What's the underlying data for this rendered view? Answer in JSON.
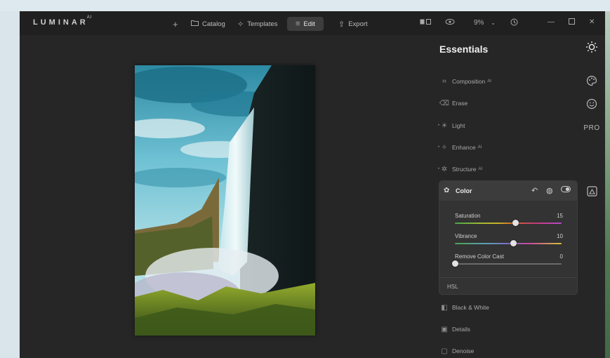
{
  "app": {
    "logo": "LUMINAR",
    "logo_suffix": "AI"
  },
  "toolbar": {
    "add_icon": "plus-icon",
    "catalog_label": "Catalog",
    "templates_label": "Templates",
    "edit_label": "Edit",
    "export_label": "Export",
    "zoom_value": "9%"
  },
  "panel": {
    "title": "Essentials",
    "tools": [
      {
        "label": "Composition",
        "badge": "AI"
      },
      {
        "label": "Erase",
        "badge": ""
      },
      {
        "label": "Light",
        "badge": ""
      },
      {
        "label": "Enhance",
        "badge": "AI"
      },
      {
        "label": "Structure",
        "badge": "AI"
      }
    ],
    "color": {
      "title": "Color",
      "sliders": [
        {
          "label": "Saturation",
          "value": "15",
          "fraction": 0.57
        },
        {
          "label": "Vibrance",
          "value": "10",
          "fraction": 0.55
        },
        {
          "label": "Remove Color Cast",
          "value": "0",
          "fraction": 0.0
        }
      ],
      "hsl_label": "HSL"
    },
    "more_tools": [
      {
        "label": "Black & White"
      },
      {
        "label": "Details"
      },
      {
        "label": "Denoise"
      }
    ]
  },
  "rail": {
    "items": [
      "sun-icon",
      "palette-icon",
      "smiley-icon",
      "pro-label",
      "portrait-icon"
    ],
    "pro_text": "PRO"
  },
  "colors": {
    "background": "#262626",
    "titlebar": "#202020",
    "accent_text": "#f0f0f0"
  }
}
